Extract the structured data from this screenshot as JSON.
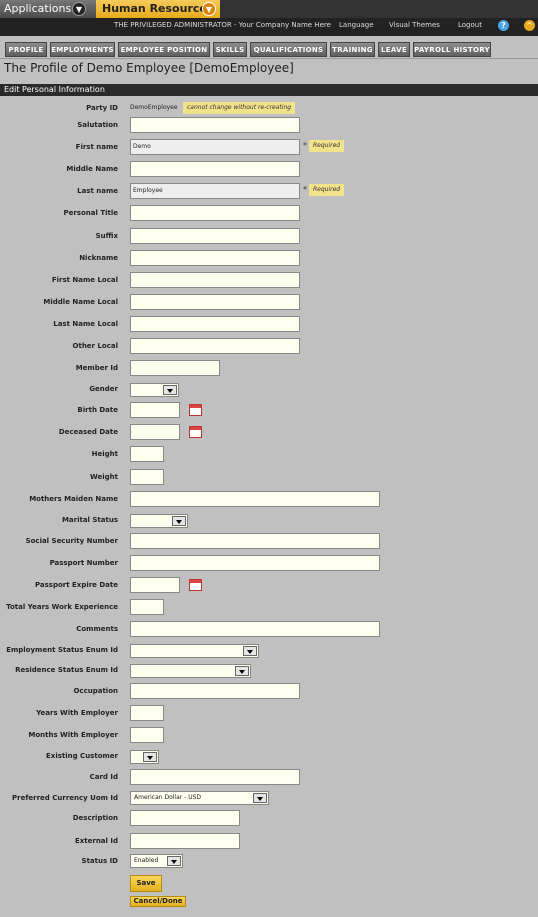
{
  "header": {
    "applications_label": "Applications",
    "app_name": "Human Resources",
    "user_text": "THE PRIVILEGED ADMINISTRATOR - Your Company Name Here",
    "language": "Language",
    "visual_themes": "Visual Themes",
    "logout": "Logout",
    "help_icon": "?",
    "up_icon": "^"
  },
  "tabs": [
    "PROFILE",
    "EMPLOYMENTS",
    "EMPLOYEE POSITION",
    "SKILLS",
    "QUALIFICATIONS",
    "TRAINING",
    "LEAVE",
    "PAYROLL HISTORY"
  ],
  "page_title": "The Profile of Demo Employee [DemoEmployee]",
  "section_header": "Edit Personal Information",
  "form": {
    "party_id_label": "Party ID",
    "party_id_value": "DemoEmployee",
    "party_id_note": "cannot change without re-creating",
    "required_text": "Required",
    "required_star": "*",
    "fields": [
      {
        "label": "Salutation",
        "value": ""
      },
      {
        "label": "First name",
        "value": "Demo"
      },
      {
        "label": "Middle Name",
        "value": ""
      },
      {
        "label": "Last name",
        "value": "Employee"
      },
      {
        "label": "Personal Title",
        "value": ""
      },
      {
        "label": "Suffix",
        "value": ""
      },
      {
        "label": "Nickname",
        "value": ""
      },
      {
        "label": "First Name Local",
        "value": ""
      },
      {
        "label": "Middle Name Local",
        "value": ""
      },
      {
        "label": "Last Name Local",
        "value": ""
      },
      {
        "label": "Other Local",
        "value": ""
      },
      {
        "label": "Member Id",
        "value": ""
      },
      {
        "label": "Gender",
        "value": ""
      },
      {
        "label": "Birth Date",
        "value": ""
      },
      {
        "label": "Deceased Date",
        "value": ""
      },
      {
        "label": "Height",
        "value": ""
      },
      {
        "label": "Weight",
        "value": ""
      },
      {
        "label": "Mothers Maiden Name",
        "value": ""
      },
      {
        "label": "Marital Status",
        "value": ""
      },
      {
        "label": "Social Security Number",
        "value": ""
      },
      {
        "label": "Passport Number",
        "value": ""
      },
      {
        "label": "Passport Expire Date",
        "value": ""
      },
      {
        "label": "Total Years Work Experience",
        "value": ""
      },
      {
        "label": "Comments",
        "value": ""
      },
      {
        "label": "Employment Status Enum Id",
        "value": ""
      },
      {
        "label": "Residence Status Enum Id",
        "value": ""
      },
      {
        "label": "Occupation",
        "value": ""
      },
      {
        "label": "Years With Employer",
        "value": ""
      },
      {
        "label": "Months With Employer",
        "value": ""
      },
      {
        "label": "Existing Customer",
        "value": ""
      },
      {
        "label": "Card Id",
        "value": ""
      },
      {
        "label": "Preferred Currency Uom Id",
        "value": "American Dollar - USD"
      },
      {
        "label": "Description",
        "value": ""
      },
      {
        "label": "External Id",
        "value": ""
      },
      {
        "label": "Status ID",
        "value": "Enabled"
      }
    ],
    "save_label": "Save",
    "cancel_label": "Cancel/Done"
  }
}
